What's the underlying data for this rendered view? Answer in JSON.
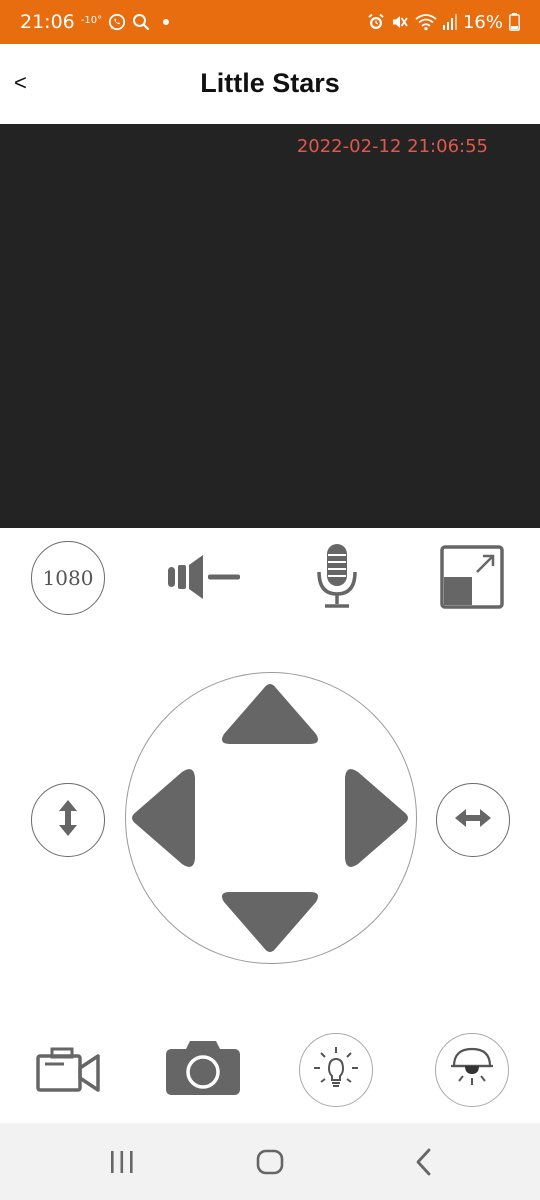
{
  "status_bar": {
    "time": "21:06",
    "temperature": "-10°",
    "battery": "16%",
    "icons_left": [
      "whatsapp-icon",
      "search-icon",
      "dot-icon"
    ],
    "icons_right": [
      "alarm-icon",
      "mute-icon",
      "wifi-icon",
      "signal-icon",
      "battery-icon"
    ]
  },
  "header": {
    "back_label": "<",
    "title": "Little Stars"
  },
  "video": {
    "timestamp": "2022-02-12 21:06:55"
  },
  "controls": {
    "resolution_label": "1080",
    "speaker_icon": "speaker-icon",
    "microphone_icon": "microphone-icon",
    "fullscreen_icon": "fullscreen-icon"
  },
  "ptz": {
    "vertical_flip_icon": "vertical-flip-icon",
    "horizontal_flip_icon": "horizontal-flip-icon",
    "arrows": [
      "up",
      "down",
      "left",
      "right"
    ]
  },
  "bottom_controls": [
    "record-video-icon",
    "camera-snapshot-icon",
    "light-bulb-icon",
    "night-light-icon"
  ],
  "nav": [
    "recent-apps",
    "home",
    "back"
  ],
  "colors": {
    "status_bar": "#e86d0f",
    "video_bg": "#232323",
    "timestamp": "#e2574c",
    "icon_gray": "#666666"
  }
}
